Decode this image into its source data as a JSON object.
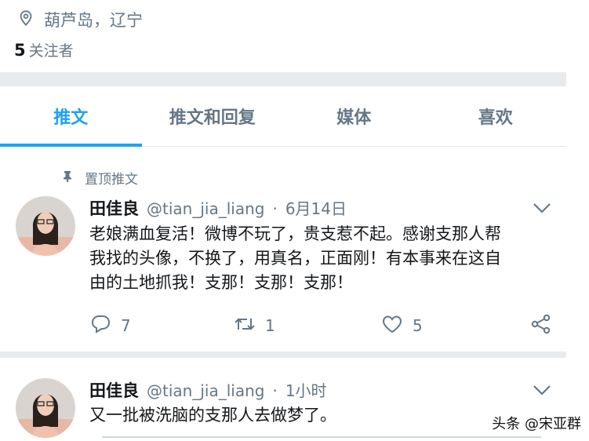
{
  "profile": {
    "location": "葫芦岛，辽宁",
    "followers_count": "5",
    "followers_label": "关注者"
  },
  "tabs": [
    {
      "label": "推文",
      "active": true
    },
    {
      "label": "推文和回复",
      "active": false
    },
    {
      "label": "媒体",
      "active": false
    },
    {
      "label": "喜欢",
      "active": false
    }
  ],
  "tweets": [
    {
      "pinned_label": "置顶推文",
      "name": "田佳良",
      "handle": "@tian_jia_liang",
      "dot": "·",
      "time": "6月14日",
      "lines": [
        "老娘满血复活！微博不玩了，贵支惹不起。感谢支那人帮",
        "我找的头像，不换了，用真名，正面刚！有本事来在这自",
        "由的土地抓我！支那！支那！支那！"
      ],
      "replies": "7",
      "retweets": "1",
      "likes": "5"
    },
    {
      "name": "田佳良",
      "handle": "@tian_jia_liang",
      "dot": "·",
      "time": "1小时",
      "lines": [
        "又一批被洗脑的支那人去做梦了。"
      ]
    }
  ],
  "watermark": "头条 @宋亚群",
  "colors": {
    "accent": "#1da1f2",
    "secondary_text": "#657786",
    "band": "#e8ebee"
  }
}
